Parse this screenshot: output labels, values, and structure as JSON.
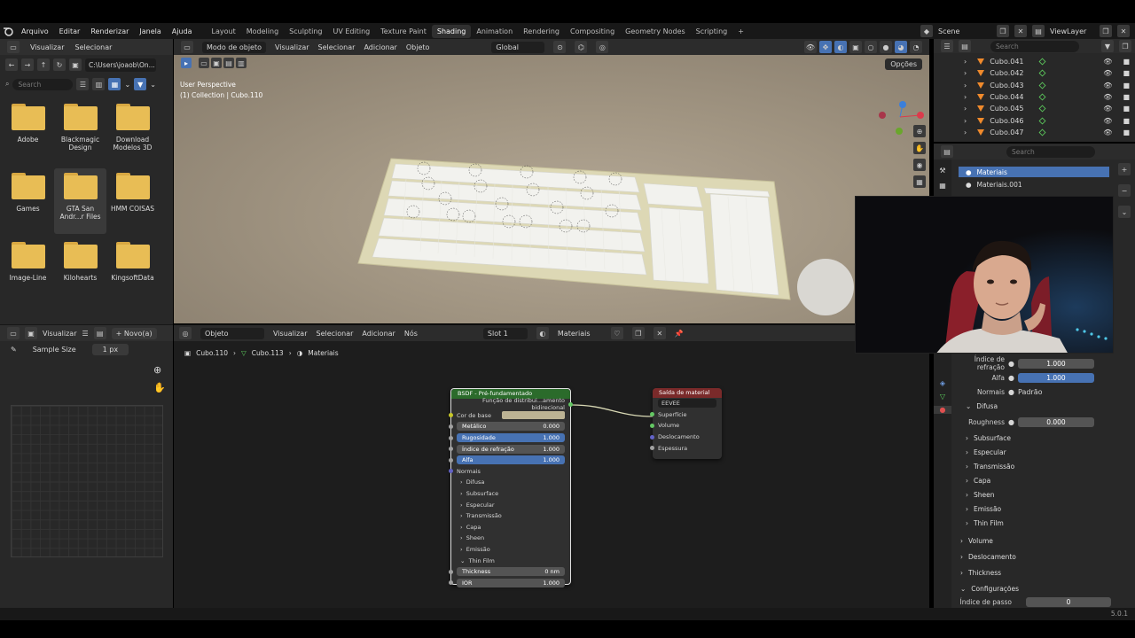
{
  "menu": [
    "Arquivo",
    "Editar",
    "Renderizar",
    "Janela",
    "Ajuda"
  ],
  "workspaces": [
    "Layout",
    "Modeling",
    "Sculpting",
    "UV Editing",
    "Texture Paint",
    "Shading",
    "Animation",
    "Rendering",
    "Compositing",
    "Geometry Nodes",
    "Scripting"
  ],
  "workspace_active": "Shading",
  "topright": {
    "scene": "Scene",
    "viewlayer": "ViewLayer"
  },
  "filebrowser": {
    "header": [
      "Visualizar",
      "Selecionar"
    ],
    "path": "C:\\Users\\joaob\\On...",
    "search_placeholder": "Search",
    "folders": [
      "Adobe",
      "Blackmagic Design",
      "Download Modelos 3D",
      "Games",
      "GTA San Andr...r Files",
      "HMM COISAS",
      "Image-Line",
      "Kilohearts",
      "KingsoftData"
    ]
  },
  "imgeditor": {
    "view": "Visualizar",
    "new": "+ Novo(a)",
    "sample_label": "Sample Size",
    "sample_value": "1 px"
  },
  "viewport": {
    "mode": "Modo de objeto",
    "menus": [
      "Visualizar",
      "Selecionar",
      "Adicionar",
      "Objeto"
    ],
    "orientation": "Global",
    "options": "Opções",
    "overlay_line1": "User Perspective",
    "overlay_line2": "(1) Collection | Cubo.110"
  },
  "nodeeditor": {
    "type": "Objeto",
    "menus": [
      "Visualizar",
      "Selecionar",
      "Adicionar",
      "Nós"
    ],
    "slot": "Slot 1",
    "material": "Materiais",
    "breadcrumb": [
      "Cubo.110",
      "Cubo.113",
      "Materiais"
    ],
    "bsdf": {
      "title": "BSDF - Pré-fundamentado",
      "distribution": "Função de distribui...amento bidirecional",
      "base_color": "Cor de base",
      "metallic": {
        "label": "Metálico",
        "value": "0.000"
      },
      "roughness": {
        "label": "Rugosidade",
        "value": "1.000"
      },
      "ior": {
        "label": "Índice de refração",
        "value": "1.000"
      },
      "alpha": {
        "label": "Alfa",
        "value": "1.000"
      },
      "normals": "Normais",
      "panels": [
        "Difusa",
        "Subsurface",
        "Especular",
        "Transmissão",
        "Capa",
        "Sheen",
        "Emissão"
      ],
      "thin_film": "Thin Film",
      "thickness": {
        "label": "Thickness",
        "value": "0 nm"
      },
      "thin_ior": {
        "label": "IOR",
        "value": "1.000"
      }
    },
    "output": {
      "title": "Saída de material",
      "target": "EEVEE",
      "inputs": [
        "Superfície",
        "Volume",
        "Deslocamento",
        "Espessura"
      ]
    }
  },
  "outliner": {
    "search_placeholder": "Search",
    "items": [
      "Cubo.041",
      "Cubo.042",
      "Cubo.043",
      "Cubo.044",
      "Cubo.045",
      "Cubo.046",
      "Cubo.047"
    ]
  },
  "properties": {
    "search_placeholder": "Search",
    "slots": [
      "Materiais",
      "Materiais.001"
    ],
    "fields": {
      "ior": {
        "label": "Índice de refração",
        "value": "1.000"
      },
      "alpha": {
        "label": "Alfa",
        "value": "1.000"
      },
      "normals": {
        "label": "Normais",
        "value": "Padrão"
      },
      "roughness": {
        "label": "Roughness",
        "value": "0.000"
      }
    },
    "difusa": "Difusa",
    "subsections": [
      "Subsurface",
      "Especular",
      "Transmissão",
      "Capa",
      "Sheen",
      "Emissão",
      "Thin Film"
    ],
    "sections": [
      "Volume",
      "Deslocamento",
      "Thickness",
      "Configurações"
    ],
    "cutoff_label": "Índice de passo",
    "cutoff_value": "0"
  },
  "version": "5.0.1",
  "colors": {
    "accent": "#4772b3",
    "bsdf_header": "#2b6b2b",
    "output_header": "#7a2a2a",
    "base_color_swatch": "#bcb394"
  }
}
